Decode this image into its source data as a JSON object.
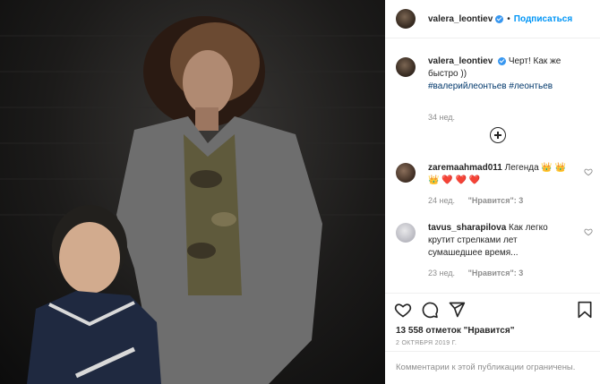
{
  "post": {
    "username": "valera_leontiev",
    "separator": "•",
    "follow_label": "Подписаться",
    "caption_text": "Черт! Как же быстро ))",
    "hashtags": "#валерийлеонтьев #леонтьев",
    "caption_time": "34 нед.",
    "likes": "13 558 отметок \"Нравится\"",
    "date": "2 ОКТЯБРЯ 2019 Г.",
    "comments_disabled": "Комментарии к этой публикации ограничены."
  },
  "comments": [
    {
      "username": "zaremaahmad011",
      "text": "Легенда 👑 👑 👑 ❤️ ❤️ ❤️",
      "time": "24 нед.",
      "likes": "\"Нравится\": 3"
    },
    {
      "username": "tavus_sharapilova",
      "text": "Как легко крутит стрелками лет сумашедшее время...",
      "time": "23 нед.",
      "likes": "\"Нравится\": 3"
    }
  ],
  "icons": {
    "like": "heart-icon",
    "comment": "comment-icon",
    "share": "share-icon",
    "save": "bookmark-icon",
    "add": "plus-circle-icon",
    "comment_like": "heart-icon"
  },
  "colors": {
    "accent": "#0095f6",
    "verified": "#3897f0",
    "text": "#262626",
    "muted": "#8e8e8e",
    "hashtag": "#00376b",
    "heart": "#ed4956"
  }
}
